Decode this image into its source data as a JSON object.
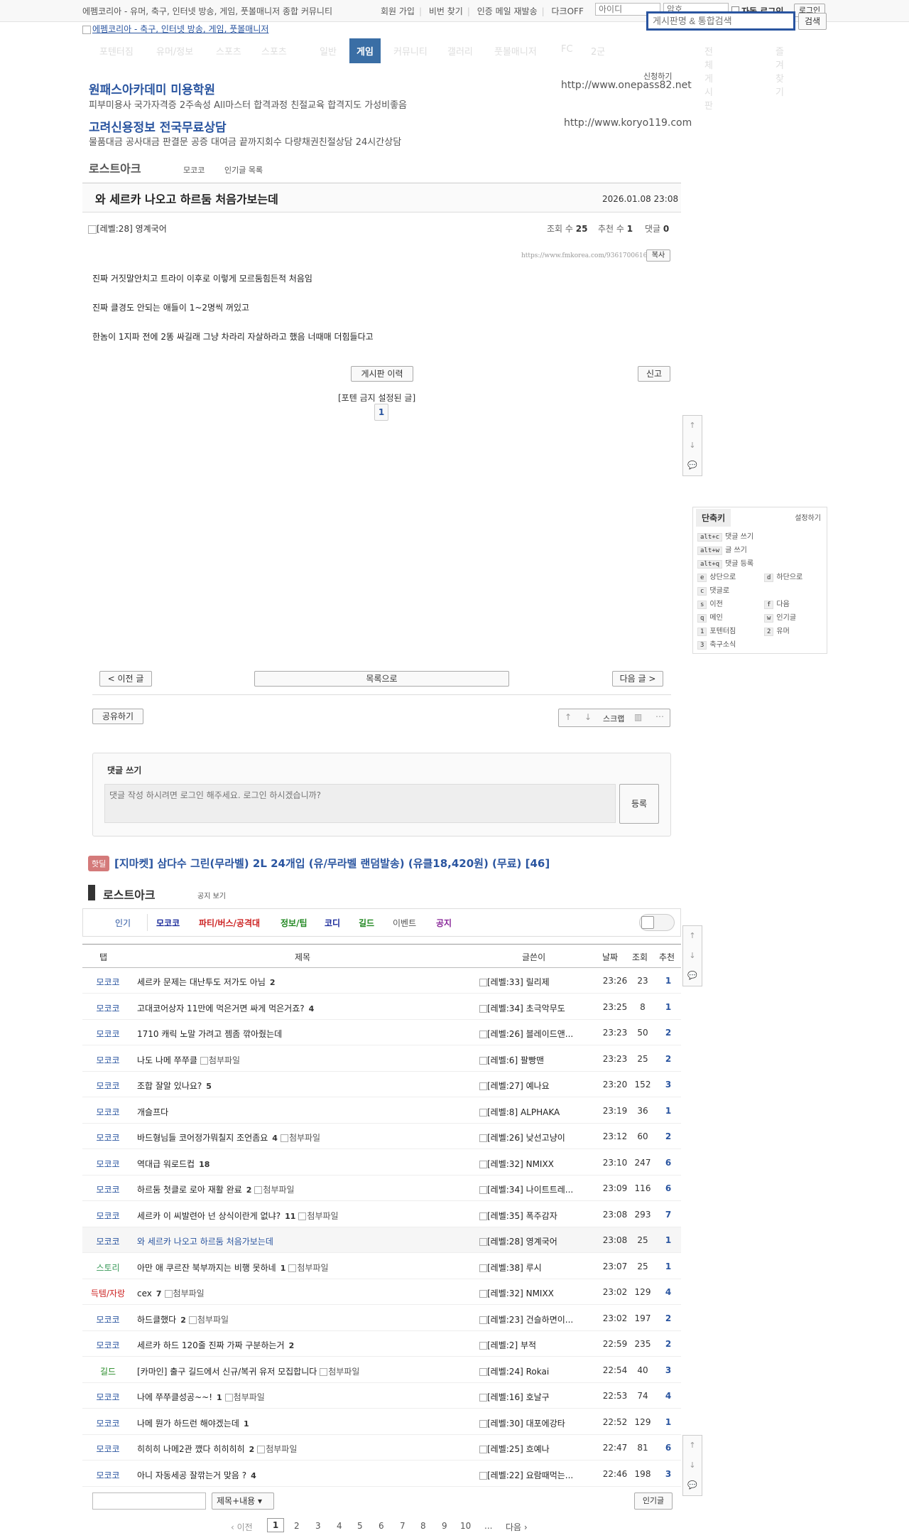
{
  "topbar": {
    "site_desc": "에펨코리아 - 유머, 축구, 인터넷 방송, 게임, 풋볼매니저 종합 커뮤니티",
    "links": [
      "회원 가입",
      "비번 찾기",
      "인증 메일 재발송",
      "다크OFF"
    ],
    "id_placeholder": "아이디",
    "pw_placeholder": "암호",
    "auto_login": "자동 로그인",
    "login": "로그인"
  },
  "logo_alt": "에펨코리아 - 축구, 인터넷 방송, 게임, 풋볼매니저",
  "search": {
    "placeholder": "게시판명 & 통합검색",
    "button": "검색"
  },
  "nav": {
    "items": [
      "포텐터짐",
      "유머/정보",
      "스포츠",
      "스포츠",
      "일반",
      "게임",
      "커뮤니티",
      "갤러리",
      "풋볼매니저",
      "FC",
      "2군",
      "전체 게시판",
      "즐겨찾기"
    ],
    "active": "게임"
  },
  "ads": {
    "apply": "신청하기",
    "items": [
      {
        "title": "원패스아카데미 미용학원",
        "desc": "피부미용사 국가자격증 2주속성 All마스터 합격과정 친절교육 합격지도 가성비좋음",
        "url": "http://www.onepass82.net"
      },
      {
        "title": "고려신용정보 전국무료상담",
        "desc": "물품대금 공사대금 판결문 공증 대여금 끝까지회수 다량채권친절상담 24시간상담",
        "url": "http://www.koryo119.com"
      }
    ]
  },
  "board": {
    "name": "로스트아크",
    "tabs": [
      "모코코",
      "인기글 목록"
    ]
  },
  "post": {
    "title": "와 세르카 나오고 하르둠 처음가보는데",
    "date": "2026.01.08 23:08",
    "author_level": "[레벨:28]",
    "author": "영계국어",
    "views_label": "조회 수",
    "views": "25",
    "rec_label": "추천 수",
    "rec": "1",
    "comments_label": "댓글",
    "comments": "0",
    "url": "https://www.fmkorea.com/9361700616",
    "copy": "복사",
    "lines": [
      "진짜 거짓말안치고 트라이 이후로 이렇게 모르둠힘든적 처음임",
      "진짜 클경도 안되는 애들이 1~2명씩 꺼있고",
      "한놈이 1지파 전에 2똥 싸길래 그냥 차라리 자살하라고 했음 너때매 더힘들다고"
    ],
    "history_btn": "게시판 이력",
    "report_btn": "신고",
    "poten_label": "[포텐 금지 설정된 글]",
    "poten_page": "1"
  },
  "float": {
    "up": "↑",
    "down": "↓",
    "chat": "💬"
  },
  "shortcuts": {
    "title": "단축키",
    "settings": "설정하기",
    "items": [
      {
        "k": "alt+c",
        "l": "댓글 쓰기"
      },
      {
        "k": "alt+w",
        "l": "글 쓰기"
      },
      {
        "k": "alt+q",
        "l": "댓글 등록"
      },
      {
        "k": "e",
        "l": "상단으로"
      },
      {
        "k": "d",
        "l": "하단으로"
      },
      {
        "k": "c",
        "l": "댓글로"
      },
      {
        "k": "s",
        "l": "이전"
      },
      {
        "k": "f",
        "l": "다음"
      },
      {
        "k": "q",
        "l": "메인"
      },
      {
        "k": "w",
        "l": "인기글"
      },
      {
        "k": "1",
        "l": "포텐터짐"
      },
      {
        "k": "2",
        "l": "유머"
      },
      {
        "k": "3",
        "l": "축구소식"
      }
    ]
  },
  "postnav": {
    "prev": "< 이전 글",
    "list": "목록으로",
    "next": "다음 글 >",
    "share": "공유하기",
    "scrap": "스크랩"
  },
  "comment": {
    "title": "댓글 쓰기",
    "placeholder": "댓글 작성 하시려면 로그인 해주세요. 로그인 하시겠습니까?",
    "submit": "등록"
  },
  "hotdeal": {
    "badge": "핫딜",
    "text": "[지마켓] 삼다수 그린(무라벨) 2L 24개입 (유/무라벨 랜덤발송) (유클18,420원) (무료) [46]"
  },
  "list_board": {
    "name": "로스트아크",
    "notice": "공지 보기"
  },
  "categories": [
    {
      "label": "인기",
      "color": "#2a55a0"
    },
    {
      "label": "모코코",
      "color": "#1a2a9a"
    },
    {
      "label": "파티/버스/공격대",
      "color": "#cc2222"
    },
    {
      "label": "정보/팁",
      "color": "#228822"
    },
    {
      "label": "코디",
      "color": "#1a2a9a"
    },
    {
      "label": "길드",
      "color": "#228822"
    },
    {
      "label": "이벤트",
      "color": "#555555"
    },
    {
      "label": "공지",
      "color": "#8a2a9a"
    }
  ],
  "table": {
    "headers": [
      "탭",
      "제목",
      "글쓴이",
      "날짜",
      "조회",
      "추천"
    ],
    "attach_alt": "첨부파일",
    "rows": [
      {
        "tab": "모코코",
        "tab_color": "#2a55a0",
        "title": "세르카 문제는 대난투도 저가도 아님",
        "cnt": "2",
        "att": false,
        "lvl": "[레벨:33]",
        "author": "릴리제",
        "time": "23:26",
        "views": "23",
        "rec": "1"
      },
      {
        "tab": "모코코",
        "tab_color": "#2a55a0",
        "title": "고대코어상자 11만에 먹은거면 싸게 먹은거죠?",
        "cnt": "4",
        "att": false,
        "lvl": "[레벨:34]",
        "author": "초극악무도",
        "time": "23:25",
        "views": "8",
        "rec": "1"
      },
      {
        "tab": "모코코",
        "tab_color": "#2a55a0",
        "title": "1710 캐릭 노말 가려고 젬좀 깎아줬는데",
        "cnt": "",
        "att": false,
        "lvl": "[레벨:26]",
        "author": "블레이드앤...",
        "time": "23:23",
        "views": "50",
        "rec": "2"
      },
      {
        "tab": "모코코",
        "tab_color": "#2a55a0",
        "title": "나도 나메 쭈쭈클",
        "cnt": "",
        "att": true,
        "lvl": "[레벨:6]",
        "author": "팔빵맨",
        "time": "23:23",
        "views": "25",
        "rec": "2"
      },
      {
        "tab": "모코코",
        "tab_color": "#2a55a0",
        "title": "조합 잘알 있나요?",
        "cnt": "5",
        "att": false,
        "lvl": "[레벨:27]",
        "author": "예나요",
        "time": "23:20",
        "views": "152",
        "rec": "3"
      },
      {
        "tab": "모코코",
        "tab_color": "#2a55a0",
        "title": "개슬프다",
        "cnt": "",
        "att": false,
        "lvl": "[레벨:8]",
        "author": "ALPHAKA",
        "time": "23:19",
        "views": "36",
        "rec": "1"
      },
      {
        "tab": "모코코",
        "tab_color": "#2a55a0",
        "title": "바드형님들 코어정가뭐칠지 조언좀요",
        "cnt": "4",
        "att": true,
        "lvl": "[레벨:26]",
        "author": "낮선고냥이",
        "time": "23:12",
        "views": "60",
        "rec": "2"
      },
      {
        "tab": "모코코",
        "tab_color": "#2a55a0",
        "title": "역대급 워로드컵",
        "cnt": "18",
        "att": false,
        "lvl": "[레벨:32]",
        "author": "NMIXX",
        "time": "23:10",
        "views": "247",
        "rec": "6"
      },
      {
        "tab": "모코코",
        "tab_color": "#2a55a0",
        "title": "하르둠 첫클로 로아 재활 완료",
        "cnt": "2",
        "att": true,
        "lvl": "[레벨:34]",
        "author": "나이트트레...",
        "time": "23:09",
        "views": "116",
        "rec": "6"
      },
      {
        "tab": "모코코",
        "tab_color": "#2a55a0",
        "title": "세르카 이 씨발련아 넌 상식이란게 없냐?",
        "cnt": "11",
        "att": true,
        "lvl": "[레벨:35]",
        "author": "폭주감자",
        "time": "23:08",
        "views": "293",
        "rec": "7"
      },
      {
        "tab": "모코코",
        "tab_color": "#2a55a0",
        "title": "와 세르카 나오고 하르둠 처음가보는데",
        "cnt": "",
        "att": false,
        "lvl": "[레벨:28]",
        "author": "영계국어",
        "time": "23:08",
        "views": "25",
        "rec": "1",
        "current": true
      },
      {
        "tab": "스토리",
        "tab_color": "#3a9a5a",
        "title": "아만 애 쿠르잔 북부까지는 비행 못하네",
        "cnt": "1",
        "att": true,
        "lvl": "[레벨:38]",
        "author": "루시",
        "time": "23:07",
        "views": "25",
        "rec": "1"
      },
      {
        "tab": "득템/자랑",
        "tab_color": "#cc2222",
        "title": "cex",
        "cnt": "7",
        "att": true,
        "lvl": "[레벨:32]",
        "author": "NMIXX",
        "time": "23:02",
        "views": "129",
        "rec": "4"
      },
      {
        "tab": "모코코",
        "tab_color": "#2a55a0",
        "title": "하드클했다",
        "cnt": "2",
        "att": true,
        "lvl": "[레벨:23]",
        "author": "건슬하면이...",
        "time": "23:02",
        "views": "197",
        "rec": "2"
      },
      {
        "tab": "모코코",
        "tab_color": "#2a55a0",
        "title": "세르카 하드 120줄 진짜 가짜 구분하는거",
        "cnt": "2",
        "att": false,
        "lvl": "[레벨:2]",
        "author": "부적",
        "time": "22:59",
        "views": "235",
        "rec": "2"
      },
      {
        "tab": "길드",
        "tab_color": "#228822",
        "title": "[카마인] 출구 길드에서 신규/복귀 유저 모집합니다",
        "cnt": "",
        "att": true,
        "lvl": "[레벨:24]",
        "author": "Rokai",
        "time": "22:54",
        "views": "40",
        "rec": "3"
      },
      {
        "tab": "모코코",
        "tab_color": "#2a55a0",
        "title": "나에 쭈쭈클성공~~!",
        "cnt": "1",
        "att": true,
        "lvl": "[레벨:16]",
        "author": "호날구",
        "time": "22:53",
        "views": "74",
        "rec": "4"
      },
      {
        "tab": "모코코",
        "tab_color": "#2a55a0",
        "title": "나메 뭔가 하드런 해야겠는데",
        "cnt": "1",
        "att": false,
        "lvl": "[레벨:30]",
        "author": "대포에강타",
        "time": "22:52",
        "views": "129",
        "rec": "1"
      },
      {
        "tab": "모코코",
        "tab_color": "#2a55a0",
        "title": "히히히 나메2관 깼다 히히히히",
        "cnt": "2",
        "att": true,
        "lvl": "[레벨:25]",
        "author": "흐예나",
        "time": "22:47",
        "views": "81",
        "rec": "6"
      },
      {
        "tab": "모코코",
        "tab_color": "#2a55a0",
        "title": "아니 자동세공 잘깎는거 맞음 ?",
        "cnt": "4",
        "att": false,
        "lvl": "[레벨:22]",
        "author": "요람때먹는...",
        "time": "22:46",
        "views": "198",
        "rec": "3"
      }
    ]
  },
  "bottom": {
    "search_option": "제목+내용",
    "popular": "인기글"
  },
  "pager": {
    "prev": "‹ 이전",
    "pages": [
      "1",
      "2",
      "3",
      "4",
      "5",
      "6",
      "7",
      "8",
      "9",
      "10"
    ],
    "ellipsis": "...",
    "next": "다음 ›",
    "current": "1"
  }
}
